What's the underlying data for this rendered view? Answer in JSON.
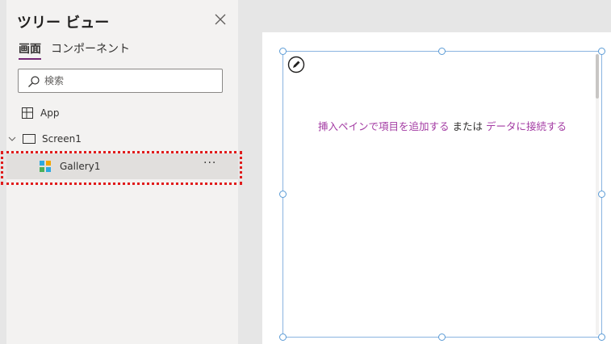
{
  "tree_view": {
    "title": "ツリー ビュー",
    "tabs": [
      {
        "label": "画面",
        "active": true
      },
      {
        "label": "コンポーネント",
        "active": false
      }
    ],
    "search": {
      "placeholder": "検索",
      "value": ""
    },
    "items": [
      {
        "label": "App",
        "icon": "app-icon"
      },
      {
        "label": "Screen1",
        "icon": "screen-icon",
        "expanded": true
      },
      {
        "label": "Gallery1",
        "icon": "gallery-icon",
        "selected": true
      }
    ],
    "more_label": "···"
  },
  "canvas": {
    "message_part1": "挿入ペインで項目を追加する",
    "message_part2": " または ",
    "message_part3": "データに接続する"
  },
  "colors": {
    "accent": "#742774",
    "link": "#a33ba3",
    "highlight": "#e01b1b",
    "selection": "#8ab4e0"
  }
}
